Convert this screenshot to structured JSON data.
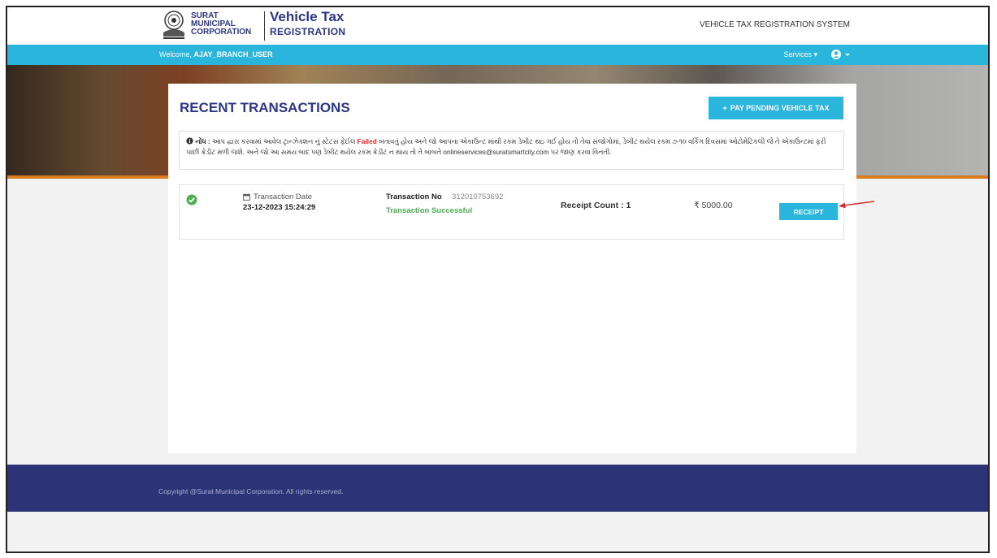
{
  "header": {
    "logo_lines": [
      "SURAT",
      "MUNICIPAL",
      "CORPORATION"
    ],
    "app_title_line1": "Vehicle Tax",
    "app_title_line2": "REGISTRATION",
    "system_title": "VEHICLE TAX REGISTRATION SYSTEM"
  },
  "nav": {
    "welcome_prefix": "Welcome,",
    "username": "AJAY_BRANCH_USER",
    "services_label": "Services ▾",
    "user_menu_label": "▾"
  },
  "card": {
    "title": "RECENT TRANSACTIONS",
    "pay_button_label": "PAY PENDING VEHICLE TAX",
    "pay_button_icon": "+"
  },
  "notice": {
    "label": "નોંધ :",
    "text_before": "આપ દ્વારા કરવામાં આવેલ ટ્રાન્ઝેક્શન નું સ્ટેટસ ફેઈલ",
    "failed_word": "Failed",
    "text_after": "બતાવતું હોય અને જો આપના એકાઉન્ટ માંથી રકમ ડેબીટ થઇ ગઈ હોય તો તેવા સંજોગોમાં, ડેબીટ થયેલ રકમ ૭-૧૦ વર્કિંગ દિવસમાં ઓટોમેટિકલી જે તે એકાઉન્ટમાં ફરી પાછી ક્રેડીટ મળી જશે. અને જો આ સમય બાદ પણ ડેબીટ થયેલ રકમ ક્રેડીટ ન થાય તો તે બાબતે onlineservices@suratsmartcity.com પર જાણ કરવા વિનંતી."
  },
  "transaction": {
    "date_label": "Transaction Date",
    "date_value": "23-12-2023 15:24:29",
    "number_label": "Transaction No",
    "number_value": "312010753692",
    "status": "Transaction Successful",
    "receipt_count_text": "Receipt Count : 1",
    "amount": "₹ 5000.00",
    "receipt_button_label": "RECEIPT"
  },
  "footer": {
    "copyright": "Copyright @Surat Municipal Corporation. All rights reserved."
  },
  "colors": {
    "primary": "#2c3687",
    "accent": "#29b5dc",
    "success": "#4caf50",
    "danger": "#e03030",
    "footer": "#2c3377",
    "arrow": "#d32f2f"
  },
  "icons": {
    "emblem": "smc-emblem-icon",
    "success": "check-circle-icon",
    "calendar": "calendar-icon",
    "user": "user-circle-icon",
    "info": "info-circle-icon",
    "annotation": "red-arrow-annotation"
  }
}
